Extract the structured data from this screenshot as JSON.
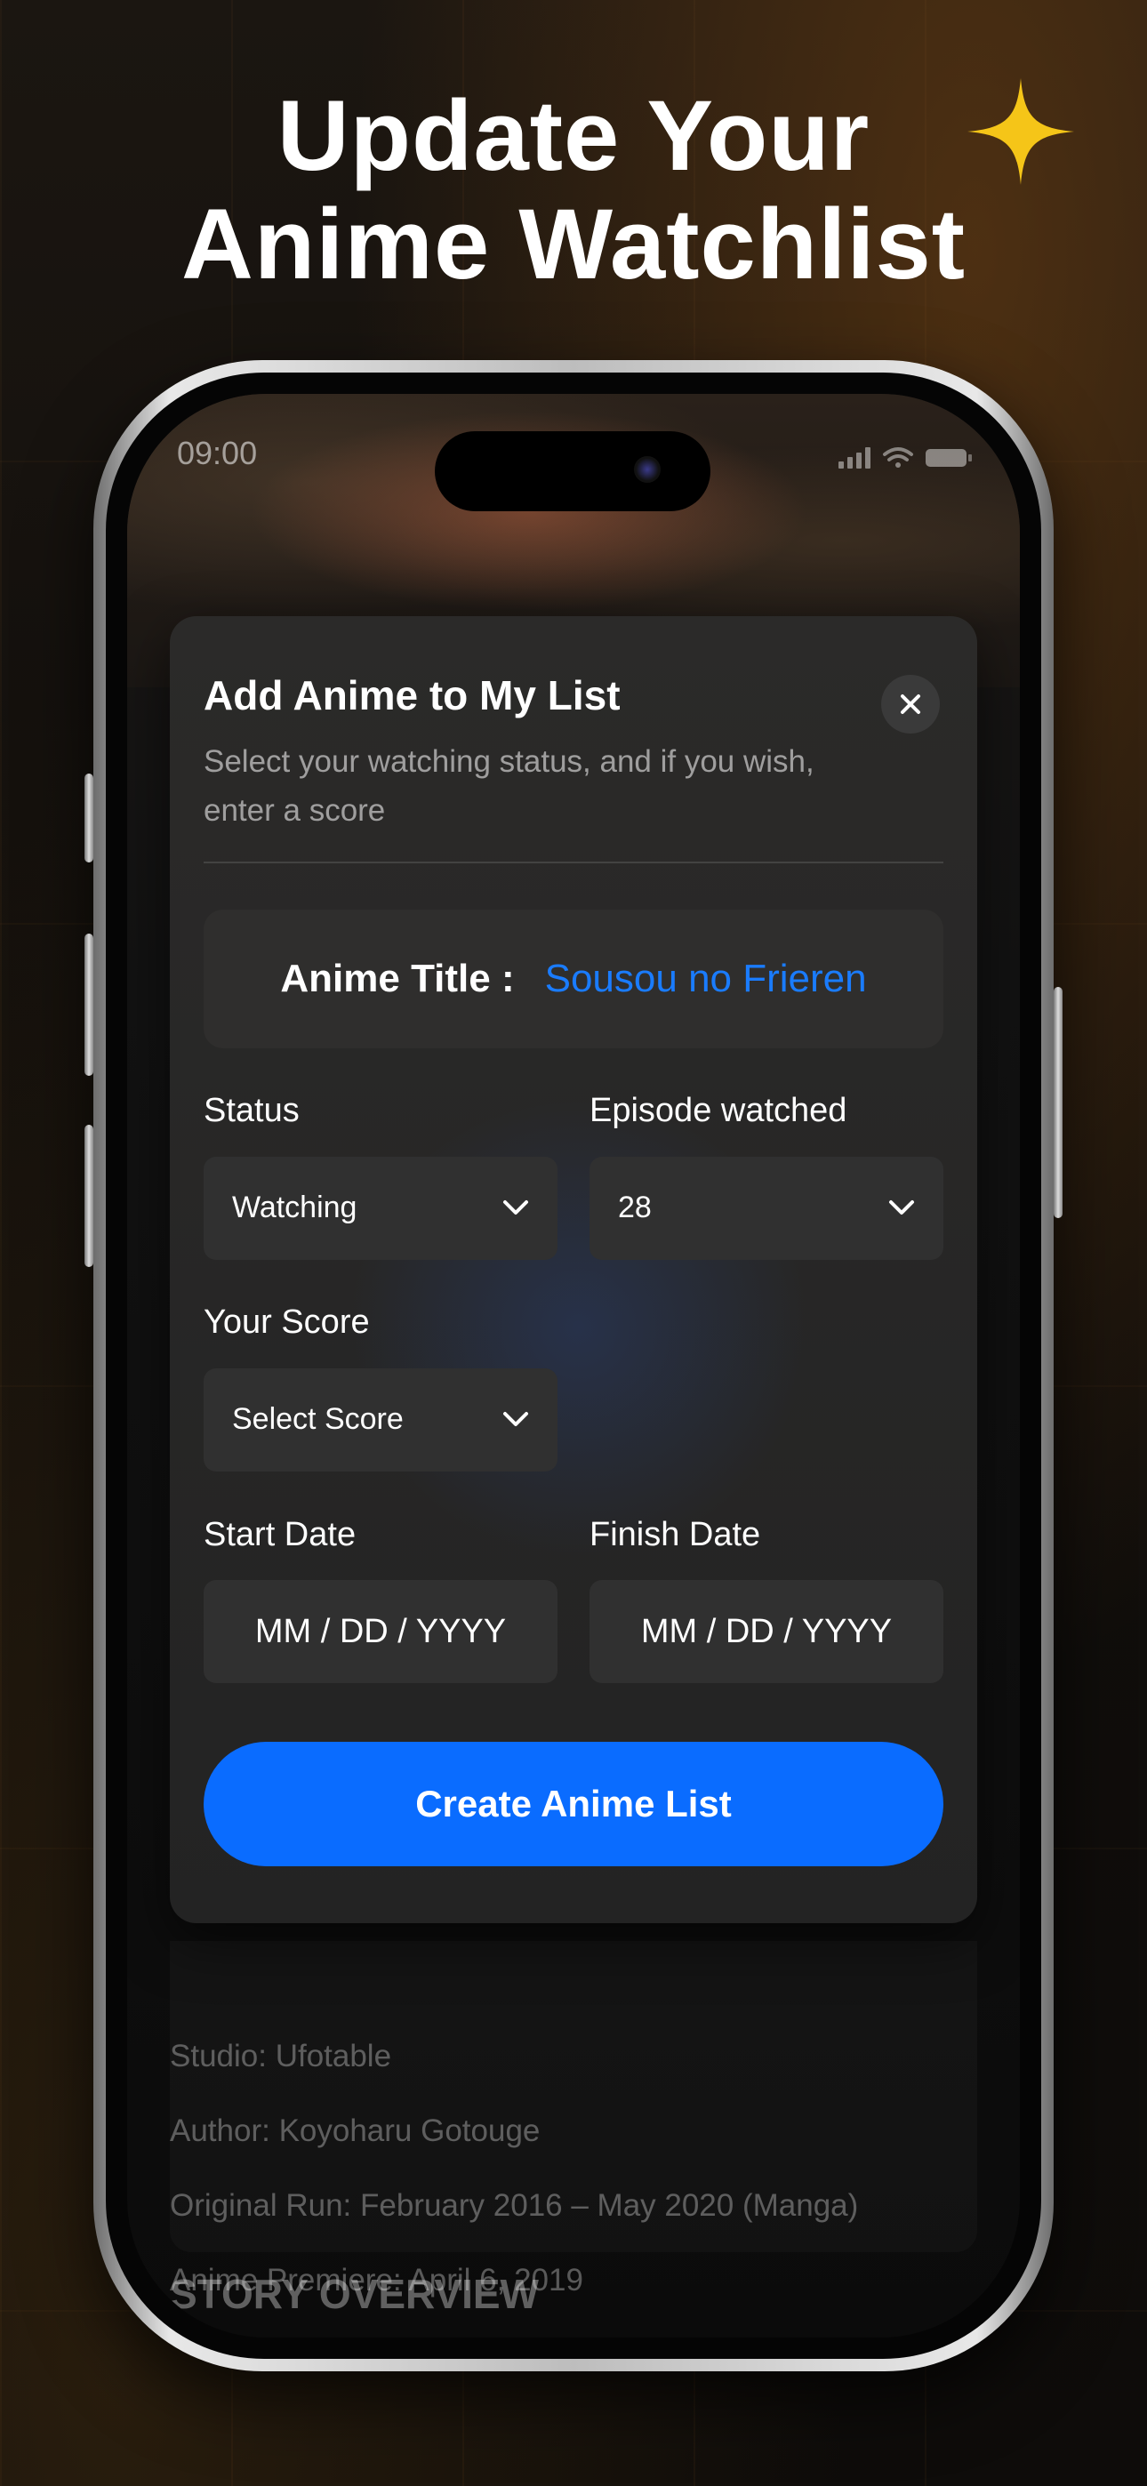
{
  "promo": {
    "headline_line1": "Update Your",
    "headline_line2": "Anime Watchlist"
  },
  "status_bar": {
    "time": "09:00"
  },
  "modal": {
    "title": "Add Anime to My List",
    "subtitle": "Select your watching status, and if you wish, enter a score",
    "anime_title_label": "Anime Title :",
    "anime_title_value": "Sousou no Frieren",
    "status_label": "Status",
    "status_value": "Watching",
    "episode_label": "Episode watched",
    "episode_value": "28",
    "score_label": "Your Score",
    "score_value": "Select Score",
    "start_date_label": "Start Date",
    "start_date_value": "MM / DD / YYYY",
    "finish_date_label": "Finish Date",
    "finish_date_value": "MM / DD / YYYY",
    "submit_label": "Create Anime List"
  },
  "details": {
    "studio": "Studio: Ufotable",
    "author": "Author: Koyoharu Gotouge",
    "original_run": "Original Run: February 2016 – May 2020 (Manga)",
    "premiere": "Anime Premiere: April 6, 2019",
    "section_title": "STORY OVERVIEW"
  },
  "colors": {
    "accent": "#0a6cff",
    "title_link": "#1a7cff",
    "sparkle": "#f5c518"
  }
}
